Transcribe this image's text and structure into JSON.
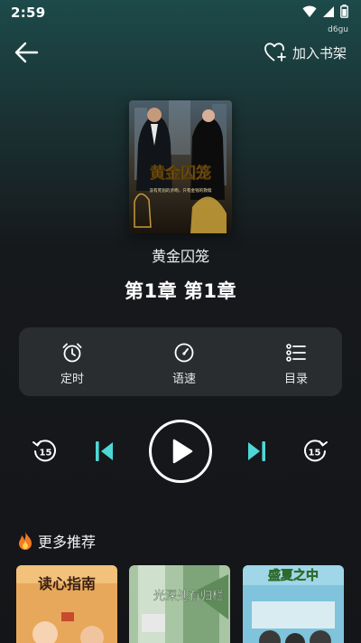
{
  "status_bar": {
    "time": "2:59",
    "device_tag": "d6gu",
    "icons": [
      "wifi-icon",
      "signal-icon",
      "battery-icon"
    ]
  },
  "header": {
    "back_icon": "arrow-left-icon",
    "add_to_shelf_label": "加入书架",
    "add_to_shelf_icon": "heart-plus-icon"
  },
  "book": {
    "title": "黄金囚笼",
    "chapter": "第1章 第1章",
    "cover": {
      "title": "黄金囚笼",
      "tagline": "没有死别的亲吻，只有金钱的救赎"
    }
  },
  "controls": [
    {
      "label": "定时",
      "icon": "alarm-clock-icon"
    },
    {
      "label": "语速",
      "icon": "speedometer-icon"
    },
    {
      "label": "目录",
      "icon": "list-icon"
    }
  ],
  "player": {
    "rewind": {
      "icon": "rewind-15-icon",
      "seconds": "15"
    },
    "previous_icon": "skip-previous-icon",
    "play_icon": "play-icon",
    "next_icon": "skip-next-icon",
    "forward": {
      "icon": "forward-15-icon",
      "seconds": "15"
    }
  },
  "recommendations": {
    "title": "更多推荐",
    "icon": "fire-icon",
    "items": [
      {
        "cover_text": "读心指南"
      },
      {
        "cover_text": "光深处有归栏"
      },
      {
        "cover_text": "盛夏之中"
      }
    ]
  },
  "colors": {
    "accent": "#4fd6d6",
    "panel": "#2a2d30",
    "background_top": "#1d4a4a",
    "background_bottom": "#141518"
  }
}
